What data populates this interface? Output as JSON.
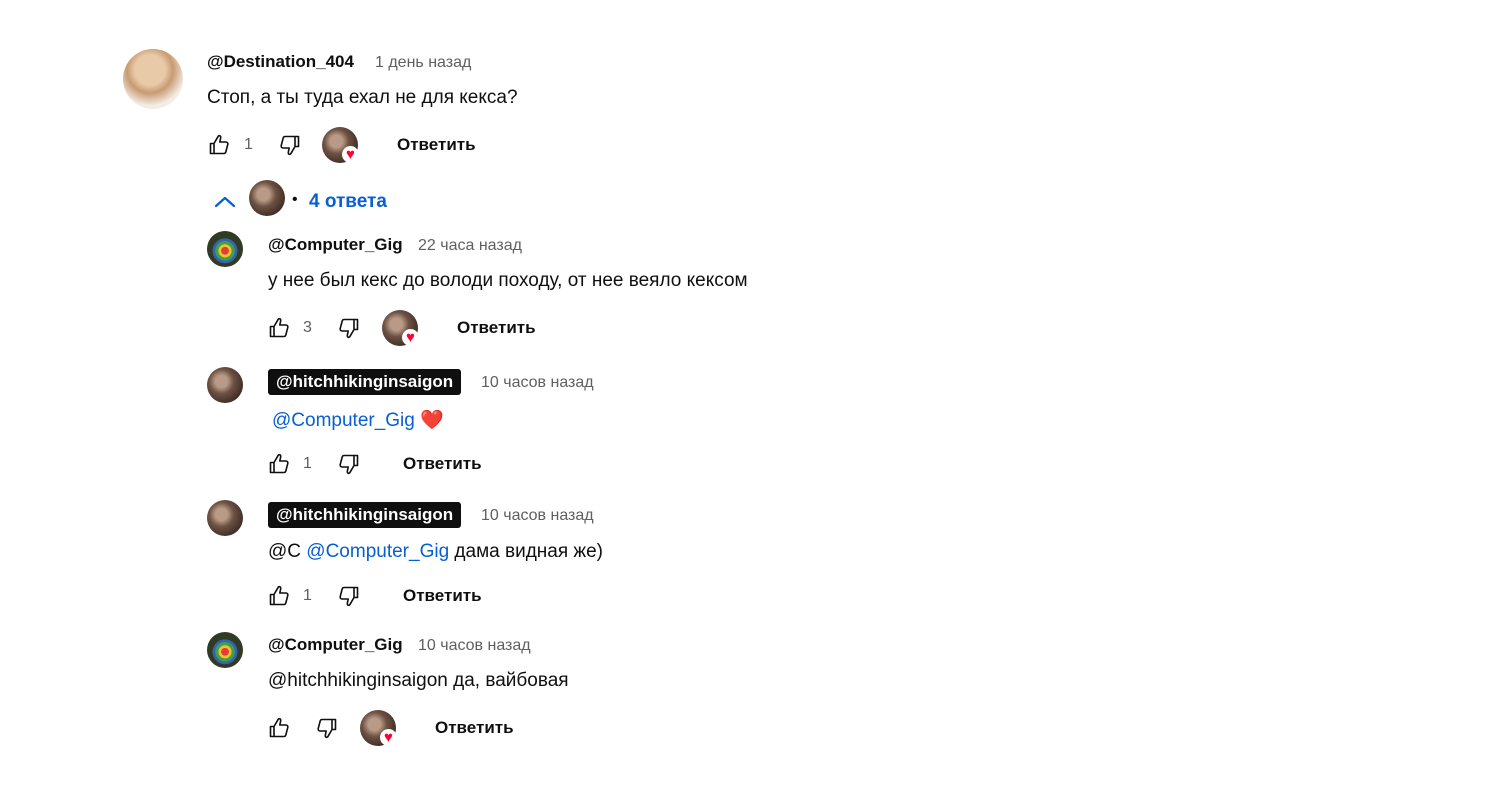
{
  "comment": {
    "author": "@Destination_404",
    "time": "1 день назад",
    "text": "Стоп, а ты туда ехал не для кекса?",
    "likes": "1",
    "reply_label": "Ответить"
  },
  "replies_toggle": {
    "label": "4 ответа",
    "bullet": "•"
  },
  "replies": [
    {
      "author": "@Computer_Gig",
      "time": "22 часа назад",
      "text": "у нее был кекс до володи походу, от нее веяло кексом",
      "likes": "3",
      "reply_label": "Ответить"
    },
    {
      "author": "@hitchhikinginsaigon",
      "time": "10 часов назад",
      "mention": "@Computer_Gig",
      "emoji": "❤️",
      "likes": "1",
      "reply_label": "Ответить"
    },
    {
      "author": "@hitchhikinginsaigon",
      "time": "10 часов назад",
      "prefix": "@C",
      "mention": "@Computer_Gig",
      "text": "дама видная же)",
      "likes": "1",
      "reply_label": "Ответить"
    },
    {
      "author": "@Computer_Gig",
      "time": "10 часов назад",
      "text": "@hitchhikinginsaigon да, вайбовая",
      "reply_label": "Ответить"
    }
  ],
  "icons": {
    "like": "thumbs-up-icon",
    "dislike": "thumbs-down-icon",
    "toggle": "chevron-up-icon",
    "creator_heart": "heart-icon"
  },
  "colors": {
    "link": "#065fd4",
    "heart": "#ff0033",
    "owner_badge": "#0f0f0f"
  }
}
